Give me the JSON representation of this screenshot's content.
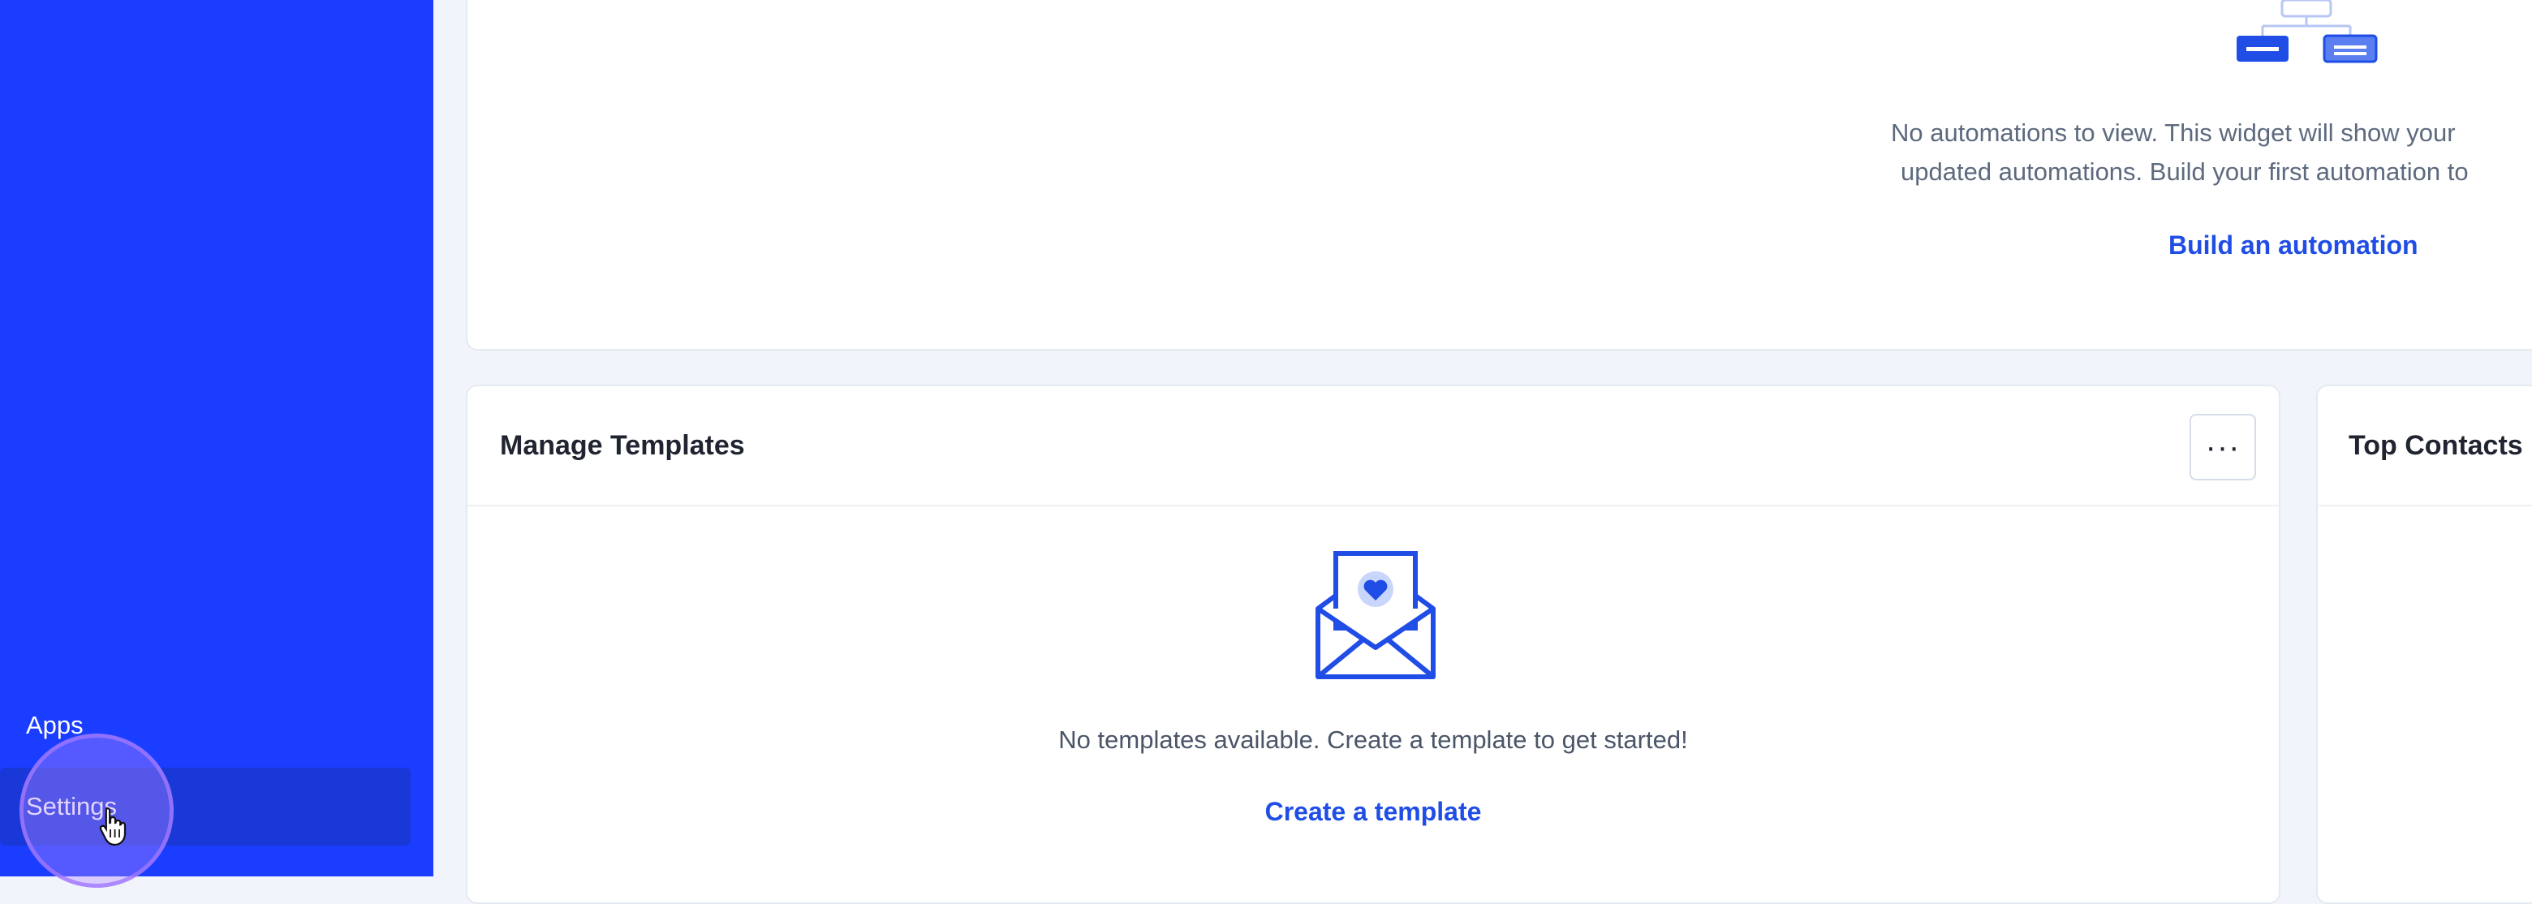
{
  "sidebar": {
    "items": [
      {
        "label": "Apps",
        "active": false
      },
      {
        "label": "Settings",
        "active": true
      }
    ]
  },
  "automations_card": {
    "empty_line_1": "No automations to view. This widget will show your",
    "empty_line_2": "updated automations. Build your first automation to",
    "cta": "Build an automation"
  },
  "templates_card": {
    "title": "Manage Templates",
    "more_label": "···",
    "empty_text": "No templates available. Create a template to get started!",
    "cta": "Create a template"
  },
  "top_contacts_card": {
    "title": "Top Contacts"
  },
  "colors": {
    "sidebar": "#1a3dff",
    "sidebar_active": "#1a37d8",
    "accent": "#1f4de6",
    "page_bg": "#f1f4fa"
  },
  "icons": [
    "flow-diagram-icon",
    "envelope-heart-icon",
    "hand-pointer-icon"
  ]
}
